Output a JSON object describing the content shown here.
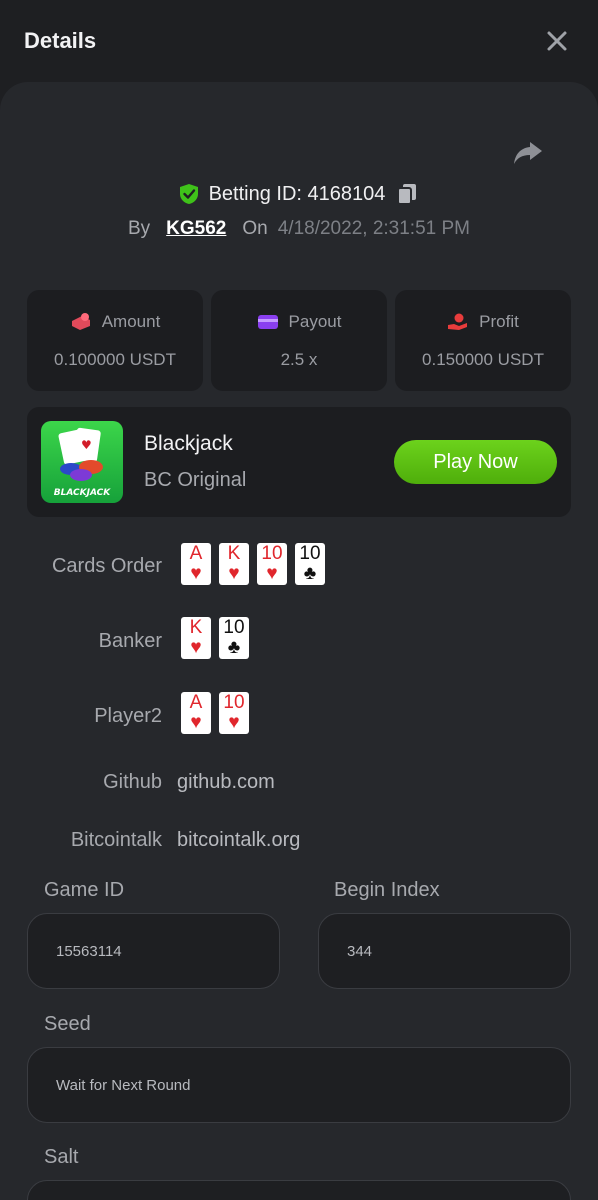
{
  "header": {
    "title": "Details"
  },
  "bet": {
    "id_label": "Betting ID: 4168104",
    "by_label": "By",
    "user": "KG562",
    "on_label": "On",
    "date": "4/18/2022, 2:31:51 PM"
  },
  "stats": [
    {
      "label": "Amount",
      "value": "0.100000 USDT",
      "icon": "amount-icon"
    },
    {
      "label": "Payout",
      "value": "2.5 x",
      "icon": "wallet-icon"
    },
    {
      "label": "Profit",
      "value": "0.150000 USDT",
      "icon": "profit-hand-icon"
    }
  ],
  "game": {
    "name": "Blackjack",
    "provider": "BC Original",
    "thumb_text": "BLACKJACK",
    "play_label": "Play Now"
  },
  "rows": {
    "cards_order_label": "Cards Order",
    "cards_order": [
      {
        "rank": "A",
        "suit": "♥"
      },
      {
        "rank": "K",
        "suit": "♥"
      },
      {
        "rank": "10",
        "suit": "♥"
      },
      {
        "rank": "10",
        "suit": "♣"
      }
    ],
    "banker_label": "Banker",
    "banker": [
      {
        "rank": "K",
        "suit": "♥"
      },
      {
        "rank": "10",
        "suit": "♣"
      }
    ],
    "player2_label": "Player2",
    "player2": [
      {
        "rank": "A",
        "suit": "♥"
      },
      {
        "rank": "10",
        "suit": "♥"
      }
    ],
    "github_label": "Github",
    "github_value": "github.com",
    "bitcointalk_label": "Bitcointalk",
    "bitcointalk_value": "bitcointalk.org"
  },
  "fields": {
    "game_id_label": "Game ID",
    "game_id": "15563114",
    "begin_index_label": "Begin Index",
    "begin_index": "344",
    "seed_label": "Seed",
    "seed": "Wait for Next Round",
    "salt_label": "Salt"
  },
  "colors": {
    "accent_green": "#5cc214",
    "panel": "#26282c",
    "card_bg": "#1c1d20",
    "suit_red": "#e0262c"
  }
}
